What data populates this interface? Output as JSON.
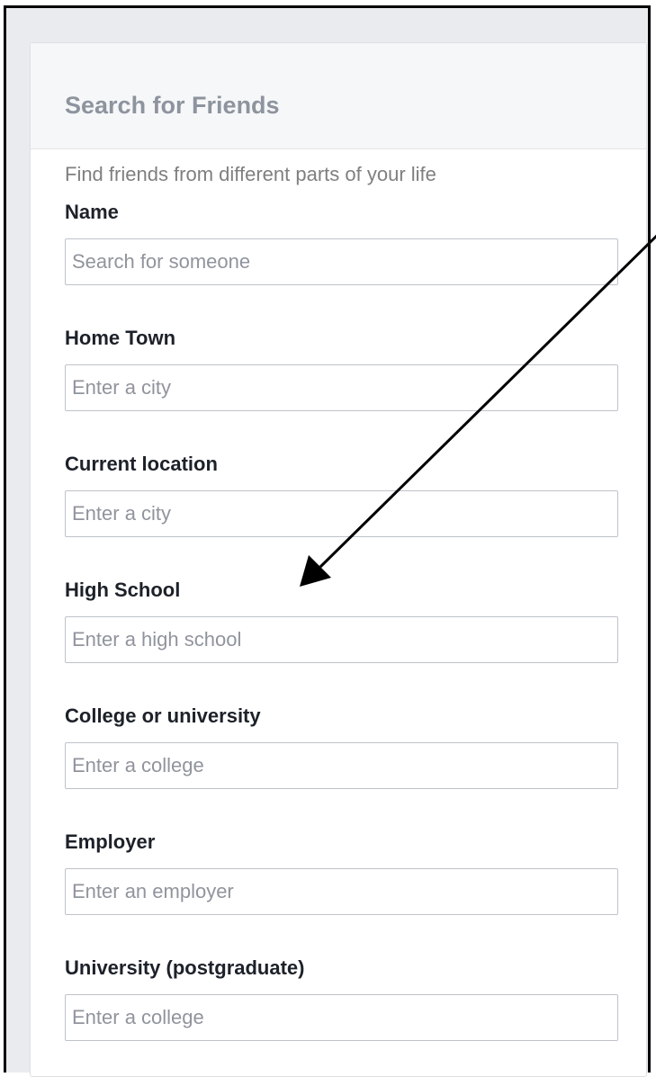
{
  "panel": {
    "title": "Search for Friends",
    "subtitle": "Find friends from different parts of your life"
  },
  "fields": {
    "name": {
      "label": "Name",
      "placeholder": "Search for someone"
    },
    "home_town": {
      "label": "Home Town",
      "placeholder": "Enter a city"
    },
    "current_location": {
      "label": "Current location",
      "placeholder": "Enter a city"
    },
    "high_school": {
      "label": "High School",
      "placeholder": "Enter a high school"
    },
    "college": {
      "label": "College or university",
      "placeholder": "Enter a college"
    },
    "employer": {
      "label": "Employer",
      "placeholder": "Enter an employer"
    },
    "postgraduate": {
      "label": "University (postgraduate)",
      "placeholder": "Enter a college"
    }
  },
  "colors": {
    "annotation_arrow": "#000000",
    "label_text": "#1d2129",
    "placeholder_text": "#90949c",
    "header_background": "#f6f7f9"
  }
}
